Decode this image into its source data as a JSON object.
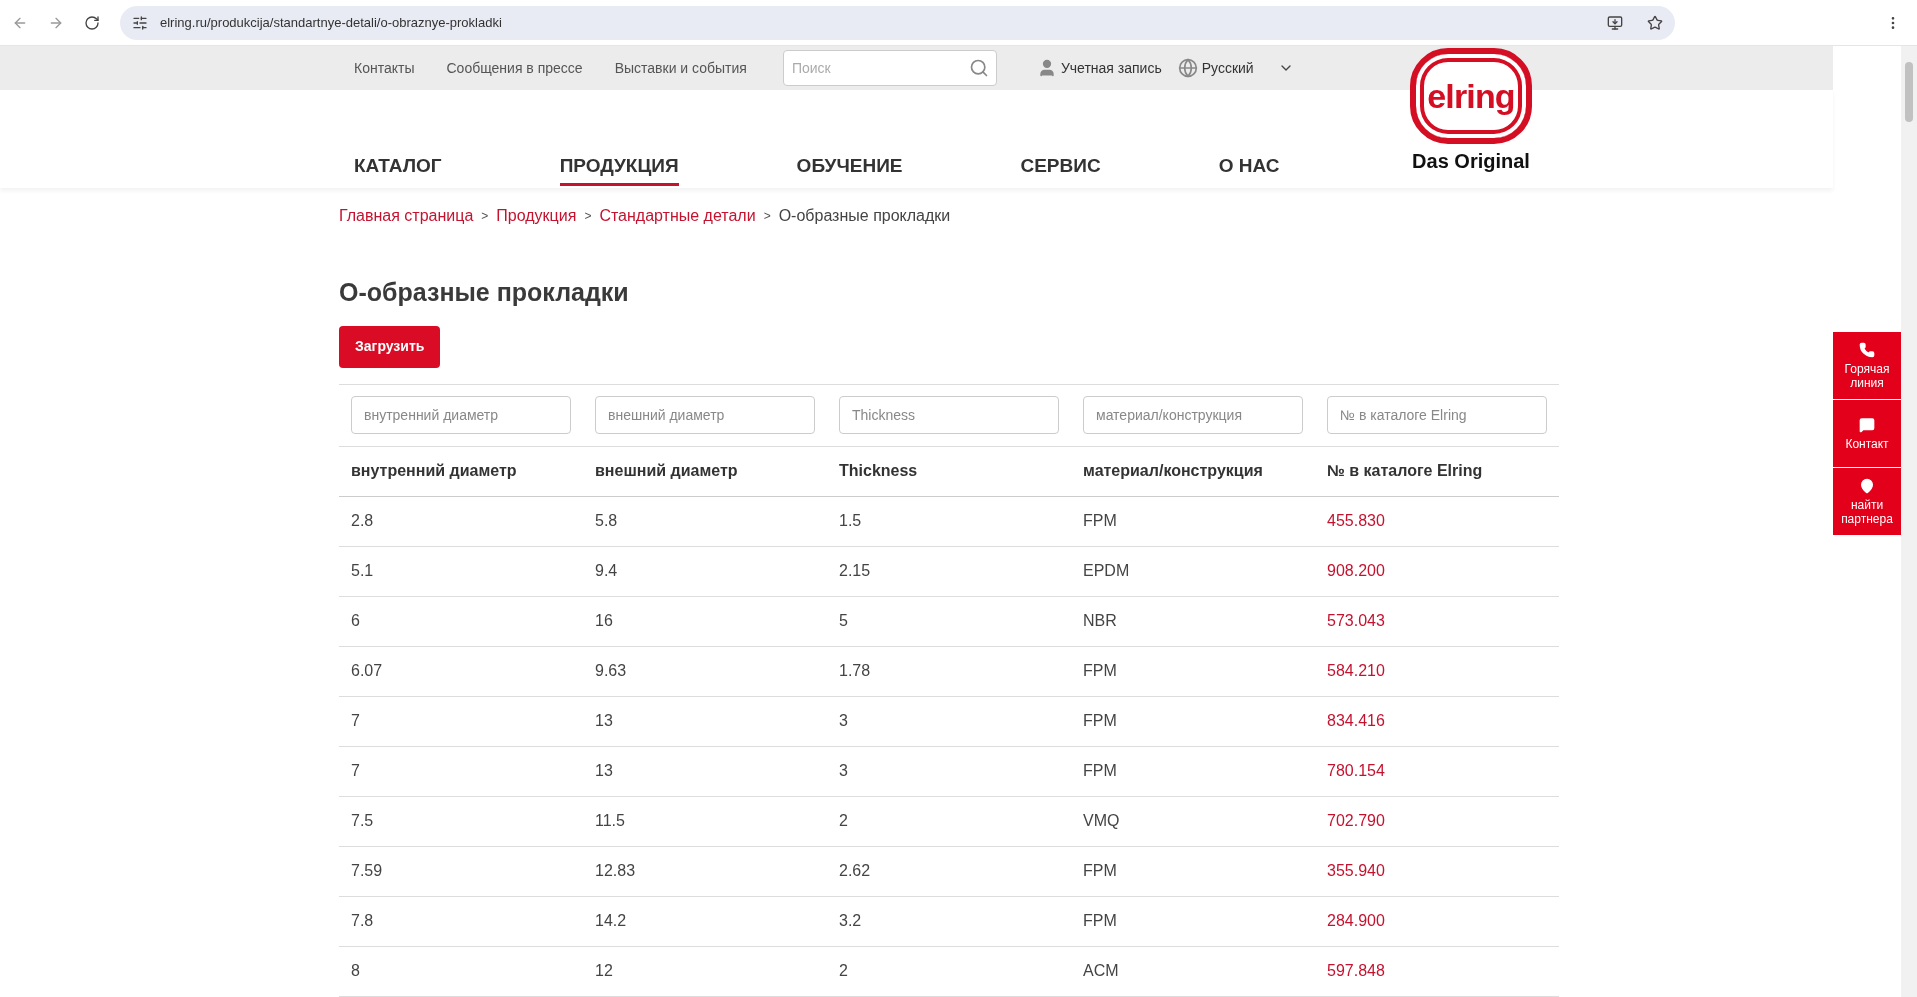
{
  "browser": {
    "url": "elring.ru/produkcija/standartnye-detali/o-obraznye-prokladki"
  },
  "top_links": [
    "Контакты",
    "Сообщения в прессе",
    "Выставки и события"
  ],
  "search": {
    "placeholder": "Поиск"
  },
  "account": "Учетная запись",
  "language": "Русский",
  "nav": [
    {
      "label": "КАТАЛОГ",
      "selected": false
    },
    {
      "label": "ПРОДУКЦИЯ",
      "selected": true
    },
    {
      "label": "ОБУЧЕНИЕ",
      "selected": false
    },
    {
      "label": "СЕРВИС",
      "selected": false
    },
    {
      "label": "О НАС",
      "selected": false
    }
  ],
  "logo": {
    "mark": "elring",
    "tagline": "Das Original"
  },
  "breadcrumb": [
    {
      "label": "Главная страница",
      "current": false
    },
    {
      "label": "Продукция",
      "current": false
    },
    {
      "label": "Стандартные детали",
      "current": false
    },
    {
      "label": "О-образные прокладки",
      "current": true
    }
  ],
  "breadcrumb_separator": ">",
  "title": "О-образные прокладки",
  "download_button": "Загрузить",
  "table": {
    "filters": [
      {
        "placeholder": "внутренний диаметр"
      },
      {
        "placeholder": "внешний диаметр"
      },
      {
        "placeholder": "Thickness"
      },
      {
        "placeholder": "материал/конструкция"
      },
      {
        "placeholder": "№ в каталоге Elring"
      }
    ],
    "columns": [
      "внутренний диаметр",
      "внешний диаметр",
      "Thickness",
      "материал/конструкция",
      "№ в каталоге Elring"
    ],
    "rows": [
      [
        "2.8",
        "5.8",
        "1.5",
        "FPM",
        "455.830"
      ],
      [
        "5.1",
        "9.4",
        "2.15",
        "EPDM",
        "908.200"
      ],
      [
        "6",
        "16",
        "5",
        "NBR",
        "573.043"
      ],
      [
        "6.07",
        "9.63",
        "1.78",
        "FPM",
        "584.210"
      ],
      [
        "7",
        "13",
        "3",
        "FPM",
        "834.416"
      ],
      [
        "7",
        "13",
        "3",
        "FPM",
        "780.154"
      ],
      [
        "7.5",
        "11.5",
        "2",
        "VMQ",
        "702.790"
      ],
      [
        "7.59",
        "12.83",
        "2.62",
        "FPM",
        "355.940"
      ],
      [
        "7.8",
        "14.2",
        "3.2",
        "FPM",
        "284.900"
      ],
      [
        "8",
        "12",
        "2",
        "ACM",
        "597.848"
      ]
    ]
  },
  "side_buttons": [
    {
      "kind": "phone",
      "label": "Горячая линия"
    },
    {
      "kind": "chat",
      "label": "Контакт"
    },
    {
      "kind": "pin",
      "label": "найти партнера"
    }
  ]
}
